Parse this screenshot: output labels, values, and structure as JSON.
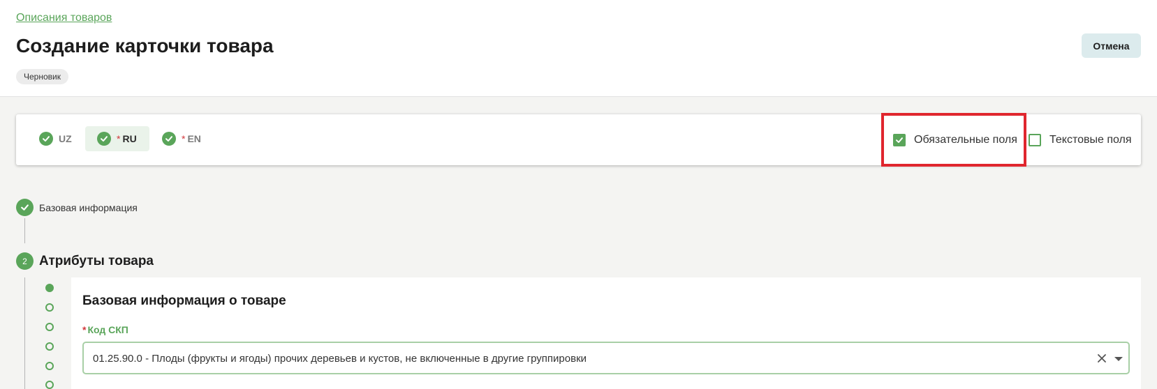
{
  "header": {
    "breadcrumb": "Описания товаров",
    "title": "Создание карточки товара",
    "status": "Черновик",
    "cancel_label": "Отмена"
  },
  "languages": [
    {
      "code": "UZ",
      "required": false,
      "complete": true,
      "active": false
    },
    {
      "code": "RU",
      "required": true,
      "complete": true,
      "active": true
    },
    {
      "code": "EN",
      "required": true,
      "complete": true,
      "active": false
    }
  ],
  "required_marker": "*",
  "filters": {
    "required_fields": {
      "label": "Обязательные поля",
      "checked": true
    },
    "text_fields": {
      "label": "Текстовые поля",
      "checked": false
    }
  },
  "steps": {
    "step1": {
      "label": "Базовая информация",
      "status": "complete"
    },
    "step2": {
      "number": "2",
      "label": "Атрибуты товара",
      "status": "current"
    }
  },
  "section": {
    "title": "Базовая информация о товаре",
    "field_label": "Код СКП",
    "field_value": "01.25.90.0 - Плоды (фрукты и ягоды) прочих деревьев и кустов, не включенные в другие группировки"
  },
  "colors": {
    "accent": "#5aa55a",
    "highlight": "#e0262e",
    "required": "#d2383c"
  }
}
